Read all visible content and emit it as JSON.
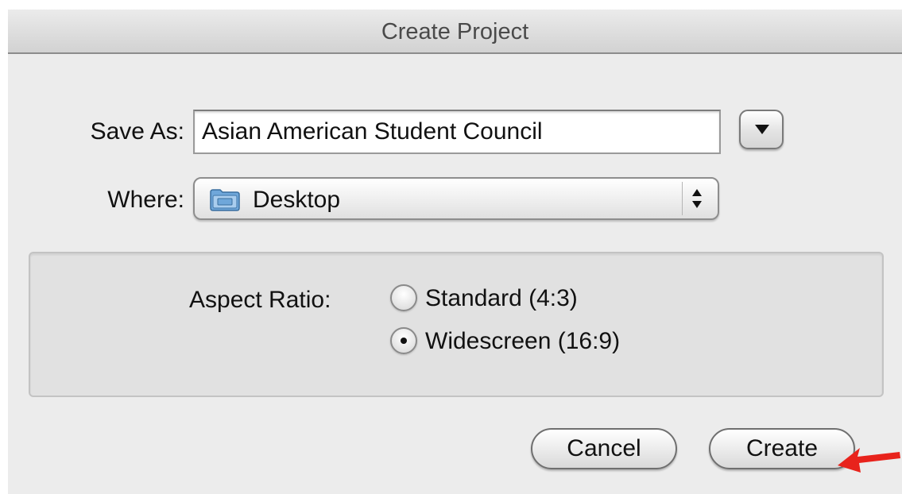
{
  "dialog": {
    "title": "Create Project"
  },
  "save_as": {
    "label": "Save As:",
    "value": "Asian American Student Council"
  },
  "where": {
    "label": "Where:",
    "value": "Desktop",
    "icon": "folder-icon"
  },
  "aspect_ratio": {
    "label": "Aspect Ratio:",
    "options": [
      {
        "label": "Standard (4:3)",
        "selected": false
      },
      {
        "label": "Widescreen (16:9)",
        "selected": true
      }
    ]
  },
  "buttons": {
    "cancel": "Cancel",
    "create": "Create"
  },
  "annotation": {
    "arrow_color": "#e8231c"
  }
}
